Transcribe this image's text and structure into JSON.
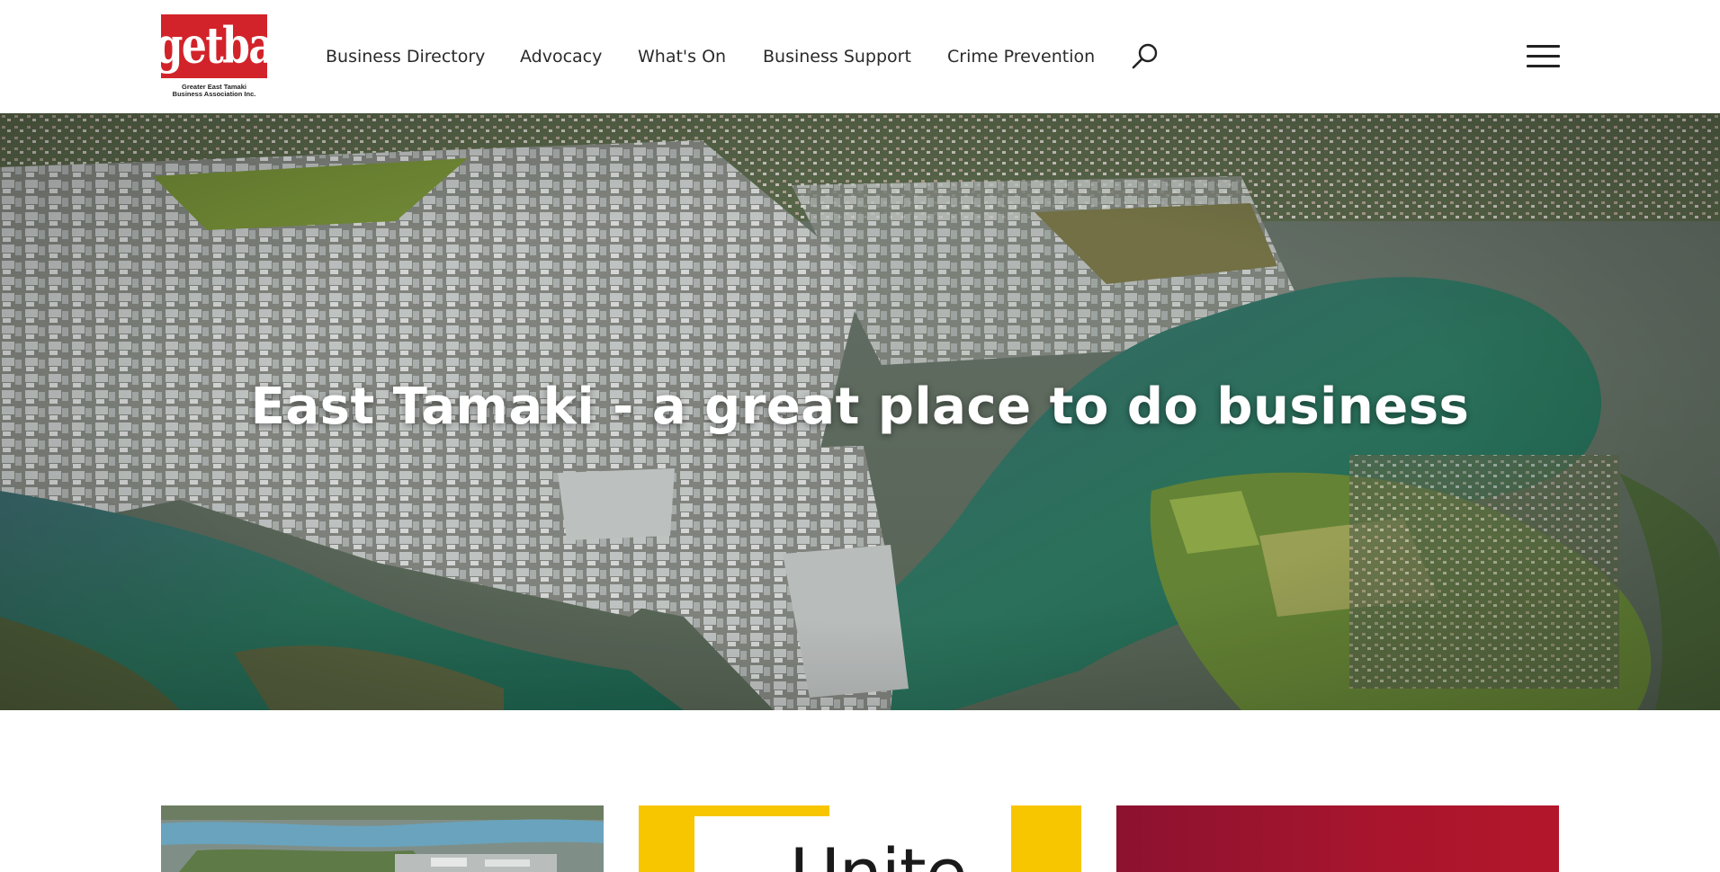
{
  "brand": {
    "logo_word": "getba",
    "logo_sub_line1": "Greater East Tamaki",
    "logo_sub_line2": "Business Association Inc.",
    "color": "#d2232a"
  },
  "nav": {
    "items": [
      {
        "label": "Business Directory"
      },
      {
        "label": "Advocacy"
      },
      {
        "label": "What's On"
      },
      {
        "label": "Business Support"
      },
      {
        "label": "Crime Prevention"
      }
    ],
    "search_icon": "search-icon",
    "menu_icon": "hamburger-menu-icon"
  },
  "hero": {
    "title": "East Tamaki - a great place to do business",
    "image": "aerial view of East Tamaki industrial area and estuary"
  },
  "cards": [
    {
      "image": "aerial view of estuary and industrial area"
    },
    {
      "visible_text": "Unite",
      "accent": "#f7c600"
    },
    {
      "accent": "#a8152d"
    }
  ]
}
